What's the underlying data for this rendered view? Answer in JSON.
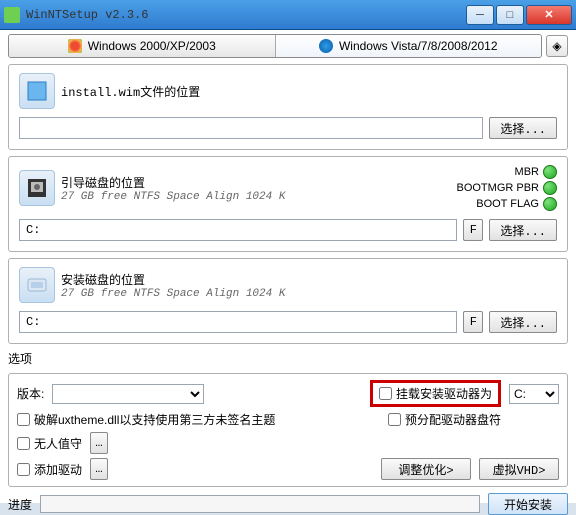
{
  "window": {
    "title": "WinNTSetup v2.3.6"
  },
  "tabs": {
    "xp": "Windows 2000/XP/2003",
    "vista": "Windows Vista/7/8/2008/2012"
  },
  "wim": {
    "label": "install.wim文件的位置",
    "path": "",
    "select": "选择..."
  },
  "boot": {
    "label": "引导磁盘的位置",
    "sub": "27 GB free NTFS Space Align 1024 K",
    "drive": "C:",
    "f": "F",
    "select": "选择...",
    "mbr": "MBR",
    "bootmgr": "BOOTMGR PBR",
    "bootflag": "BOOT FLAG"
  },
  "install": {
    "label": "安装磁盘的位置",
    "sub": "27 GB free NTFS Space Align 1024 K",
    "drive": "C:",
    "f": "F",
    "select": "选择..."
  },
  "options": {
    "heading": "选项",
    "version_label": "版本:",
    "mount_driver": "挂载安装驱动器为",
    "drive_c": "C:",
    "uxtheme": "破解uxtheme.dll以支持使用第三方未签名主题",
    "prealloc": "预分配驱动器盘符",
    "unattended": "无人值守",
    "add_driver": "添加驱动",
    "tune": "调整优化>",
    "vhd": "虚拟VHD>"
  },
  "footer": {
    "progress": "进度",
    "start": "开始安装"
  }
}
